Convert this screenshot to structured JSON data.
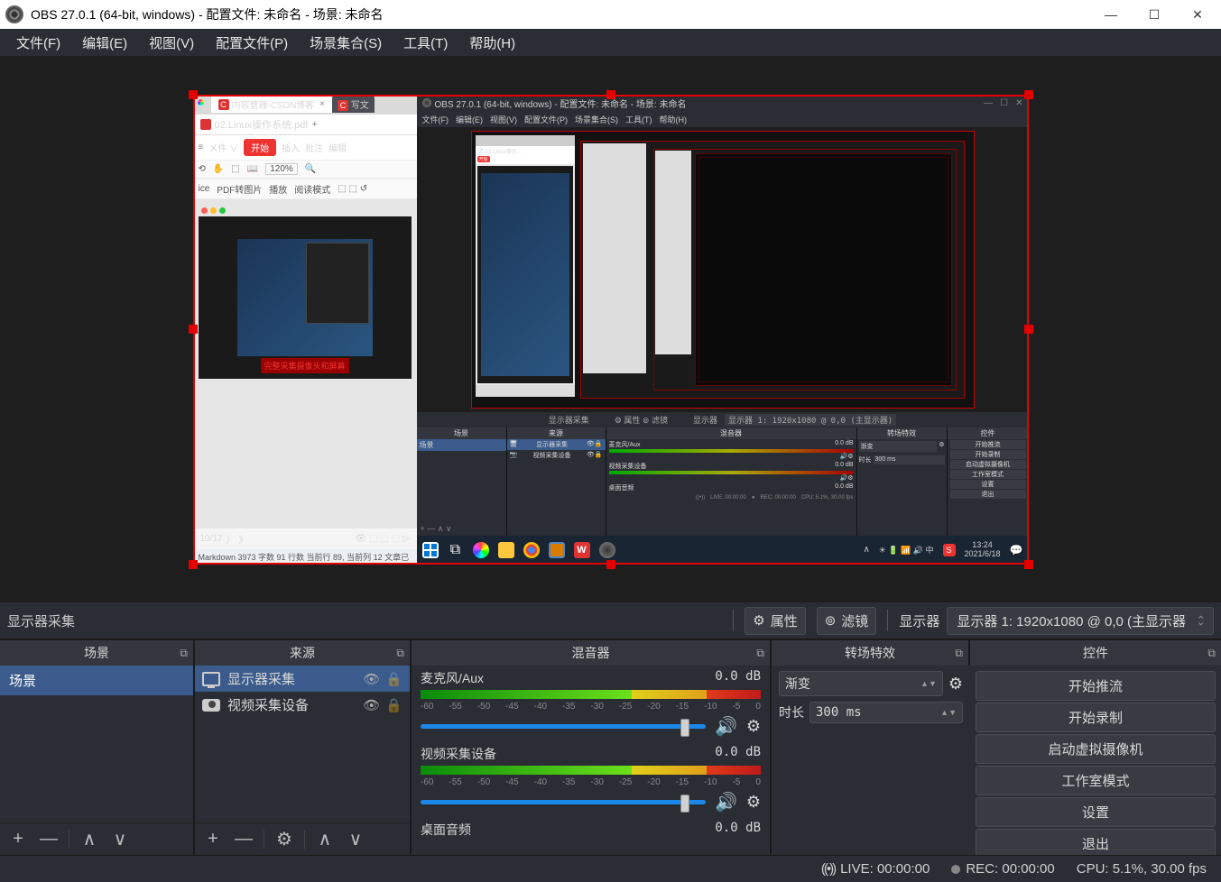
{
  "window": {
    "title": "OBS 27.0.1 (64-bit, windows) - 配置文件: 未命名 - 场景: 未命名"
  },
  "menubar": {
    "items": [
      "文件(F)",
      "编辑(E)",
      "视图(V)",
      "配置文件(P)",
      "场景集合(S)",
      "工具(T)",
      "帮助(H)"
    ]
  },
  "source_toolbar": {
    "current_source": "显示器采集",
    "properties": "属性",
    "filters": "滤镜",
    "select_label": "显示器",
    "select_value": "显示器 1: 1920x1080 @ 0,0 (主显示器"
  },
  "panels": {
    "scenes": {
      "title": "场景",
      "items": [
        "场景"
      ]
    },
    "sources": {
      "title": "来源",
      "items": [
        {
          "name": "显示器采集",
          "type": "display"
        },
        {
          "name": "视频采集设备",
          "type": "camera"
        }
      ]
    },
    "mixer": {
      "title": "混音器",
      "channels": [
        {
          "name": "麦克风/Aux",
          "level": "0.0 dB"
        },
        {
          "name": "视频采集设备",
          "level": "0.0 dB"
        },
        {
          "name": "桌面音频",
          "level": "0.0 dB"
        }
      ],
      "scale": [
        "-60",
        "-55",
        "-50",
        "-45",
        "-40",
        "-35",
        "-30",
        "-25",
        "-20",
        "-15",
        "-10",
        "-5",
        "0"
      ]
    },
    "transitions": {
      "title": "转场特效",
      "type": "渐变",
      "duration_label": "时长",
      "duration_value": "300 ms"
    },
    "controls": {
      "title": "控件",
      "buttons": [
        "开始推流",
        "开始录制",
        "启动虚拟摄像机",
        "工作室模式",
        "设置",
        "退出"
      ]
    }
  },
  "statusbar": {
    "live": "LIVE: 00:00:00",
    "rec": "REC: 00:00:00",
    "cpu": "CPU: 5.1%, 30.00 fps"
  },
  "capture_preview": {
    "tab_csdn": "内容管理-CSDN博客",
    "tab_write": "写文",
    "pdf_name": "02.Linux操作系统.pdf",
    "start_btn": "开始",
    "menu_items": [
      "插入",
      "批注",
      "编辑"
    ],
    "toolbar2_items": [
      "ice",
      "PDF转图片",
      "播放",
      "阅读模式"
    ],
    "zoom": "120%",
    "slide_title": "完整采集摄像头和屏幕",
    "page": "10/17",
    "status_md": "Markdown 3973 字数 91 行数 当前行 89, 当前列 12 文章已",
    "obs_title": "OBS 27.0.1 (64-bit, windows) - 配置文件: 未命名 - 场景: 未命名",
    "obs_menu": [
      "文件(F)",
      "编辑(E)",
      "视图(V)",
      "配置文件(P)",
      "场景集合(S)",
      "工具(T)",
      "帮助(H)"
    ],
    "obs_toolbar_text": "显示器 1: 1920x1080 @ 0,0 (主显示器)",
    "obs_prop": "属性",
    "obs_filter": "滤镜",
    "obs_display": "显示器",
    "obs_src_label": "显示器采集",
    "obs_panels": {
      "scenes": "场景",
      "sources": "来源",
      "src1": "显示器采集",
      "src2": "视频采集设备",
      "mixer": "混音器",
      "mic": "麦克风/Aux",
      "mic_db": "0.0 dB",
      "vcap": "视频采集设备",
      "vcap_db": "0.0 dB",
      "desk": "桌面音频",
      "desk_db": "0.0 dB",
      "trans": "转场特效",
      "trans_type": "渐变",
      "trans_dur_label": "时长",
      "trans_dur": "300 ms",
      "ctrl": "控件",
      "ctrls": [
        "开始推流",
        "开始录制",
        "启动虚拟摄像机",
        "工作室模式",
        "设置",
        "退出"
      ],
      "status_live": "LIVE: 00:00:00",
      "status_rec": "REC: 00:00:00",
      "status_cpu": "CPU: 5.1%, 30.00 fps"
    },
    "taskbar_time": "13:24",
    "taskbar_date": "2021/6/18"
  }
}
